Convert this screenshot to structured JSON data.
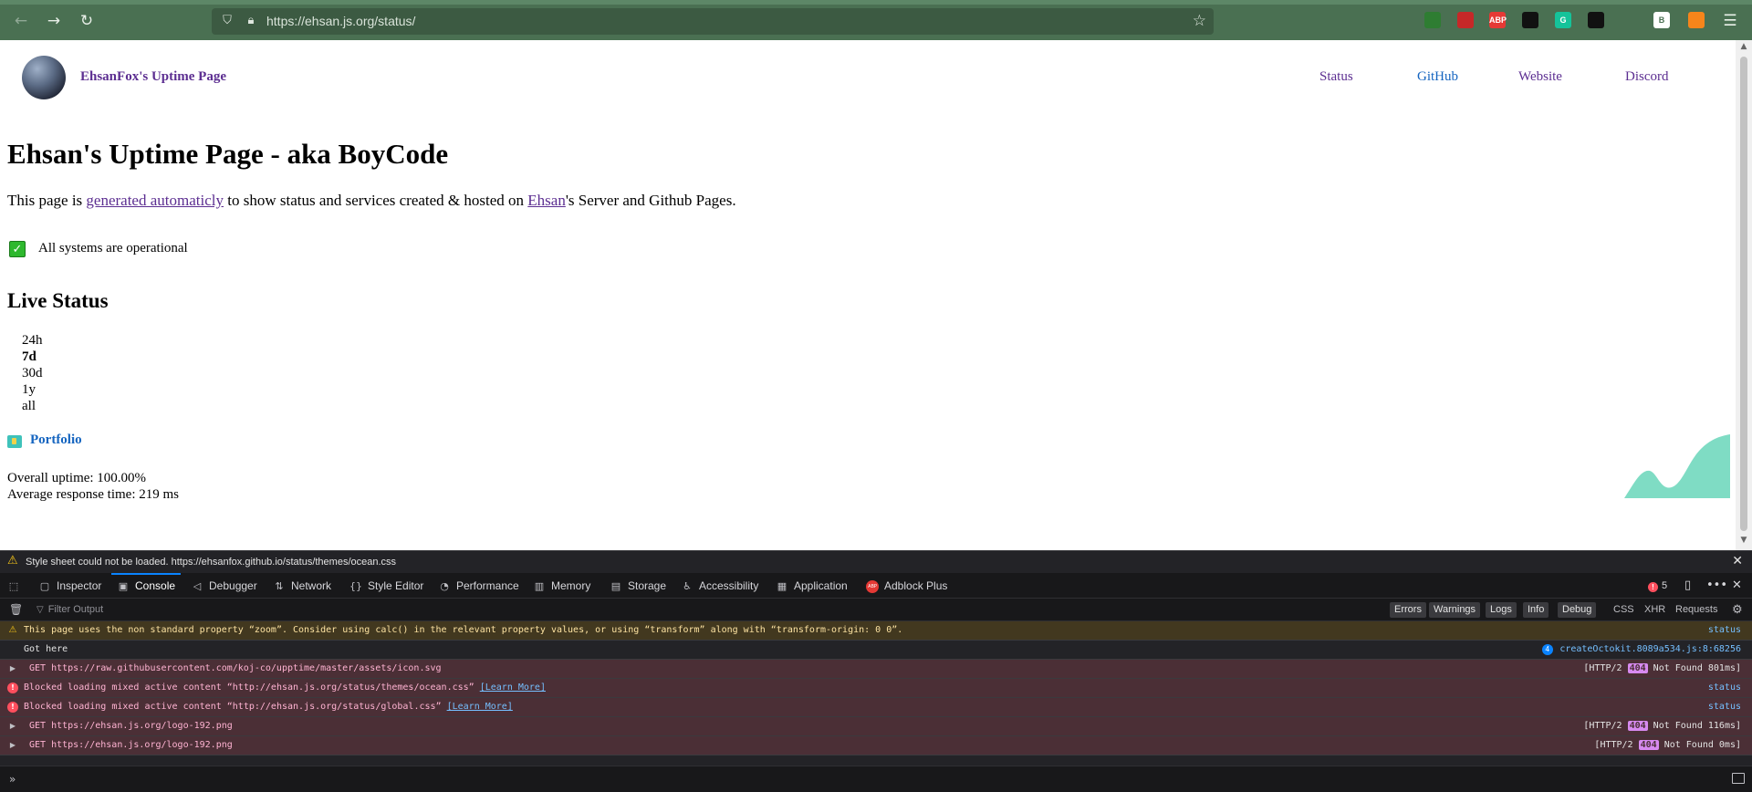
{
  "browser": {
    "url": "https://ehsan.js.org/status/",
    "back_icon": "arrow-left-icon",
    "forward_icon": "arrow-right-icon",
    "reload_icon": "reload-icon",
    "extensions": [
      {
        "name": "pocket",
        "label": "",
        "color": "#4a7052"
      },
      {
        "name": "ext-2",
        "label": "",
        "color": "#4a7052"
      },
      {
        "name": "ext-3",
        "label": "",
        "color": "#4a7052"
      },
      {
        "name": "ext-4",
        "label": "",
        "color": "#2e7d32"
      },
      {
        "name": "ext-5",
        "label": "",
        "color": "#c62828"
      },
      {
        "name": "adblock-plus",
        "label": "ABP",
        "color": "#e53935"
      },
      {
        "name": "download",
        "label": "",
        "color": "#111111"
      },
      {
        "name": "grammarly",
        "label": "G",
        "color": "#15c39a"
      },
      {
        "name": "ext-9",
        "label": "",
        "color": "#111111"
      },
      {
        "name": "ext-10",
        "label": "",
        "color": "#4a7052"
      },
      {
        "name": "ext-11",
        "label": "B",
        "color": "#ffffff"
      },
      {
        "name": "metamask",
        "label": "",
        "color": "#f6851b"
      }
    ]
  },
  "site": {
    "title": "EhsanFox's Uptime Page",
    "nav": [
      {
        "label": "Status",
        "color": "#5c2e91"
      },
      {
        "label": "GitHub",
        "color": "#1565c0"
      },
      {
        "label": "Website",
        "color": "#5c2e91"
      },
      {
        "label": "Discord",
        "color": "#5c2e91"
      }
    ]
  },
  "main": {
    "heading": "Ehsan's Uptime Page - aka BoyCode",
    "intro_pre": "This page is ",
    "intro_link1": "generated automaticly",
    "intro_mid": " to show status and services created & hosted on ",
    "intro_link2": "Ehsan",
    "intro_post": "'s Server and Github Pages.",
    "status_text": "All systems are operational",
    "live_status_title": "Live Status",
    "ranges": [
      "24h",
      "7d",
      "30d",
      "1y",
      "all"
    ],
    "selected_range": "7d",
    "portfolio_label": "Portfolio",
    "overall_uptime": "Overall uptime:  100.00%",
    "avg_response": "Average response time:  219 ms",
    "sparkline_color": "#7fdcc4"
  },
  "devtools": {
    "notice": "Style sheet could not be loaded. https://ehsanfox.github.io/status/themes/ocean.css",
    "tabs": [
      {
        "label": "Inspector",
        "icon": "▢"
      },
      {
        "label": "Console",
        "icon": "▣"
      },
      {
        "label": "Debugger",
        "icon": "◁"
      },
      {
        "label": "Network",
        "icon": "⇅"
      },
      {
        "label": "Style Editor",
        "icon": "{}"
      },
      {
        "label": "Performance",
        "icon": "◔"
      },
      {
        "label": "Memory",
        "icon": "▥"
      },
      {
        "label": "Storage",
        "icon": "▤"
      },
      {
        "label": "Accessibility",
        "icon": "♿"
      },
      {
        "label": "Application",
        "icon": "▦"
      },
      {
        "label": "Adblock Plus",
        "icon": "ABP"
      }
    ],
    "active_tab": "Console",
    "error_count": "5",
    "filter_placeholder": "Filter Output",
    "levels": [
      "Errors",
      "Warnings",
      "Logs",
      "Info",
      "Debug"
    ],
    "filters": [
      "CSS",
      "XHR",
      "Requests"
    ],
    "messages": [
      {
        "type": "warn",
        "text": "This page uses the non standard property “zoom”. Consider using calc() in the relevant property values, or using “transform” along with “transform-origin: 0 0”.",
        "source": "status"
      },
      {
        "type": "log",
        "text": "Got here",
        "badge": "4",
        "source": "createOctokit.8089a534.js:8:68256"
      },
      {
        "type": "net",
        "text": "GET https://raw.githubusercontent.com/koj-co/upptime/master/assets/icon.svg",
        "protocol": "[HTTP/2",
        "code": "404",
        "status": "Not Found 801ms]"
      },
      {
        "type": "err",
        "text": "Blocked loading mixed active content “http://ehsan.js.org/status/themes/ocean.css”",
        "learn_more": "[Learn More]",
        "source": "status"
      },
      {
        "type": "err",
        "text": "Blocked loading mixed active content “http://ehsan.js.org/status/global.css”",
        "learn_more": "[Learn More]",
        "source": "status"
      },
      {
        "type": "net",
        "text": "GET https://ehsan.js.org/logo-192.png",
        "protocol": "[HTTP/2",
        "code": "404",
        "status": "Not Found 116ms]"
      },
      {
        "type": "net",
        "text": "GET https://ehsan.js.org/logo-192.png",
        "protocol": "[HTTP/2",
        "code": "404",
        "status": "Not Found 0ms]"
      }
    ]
  }
}
